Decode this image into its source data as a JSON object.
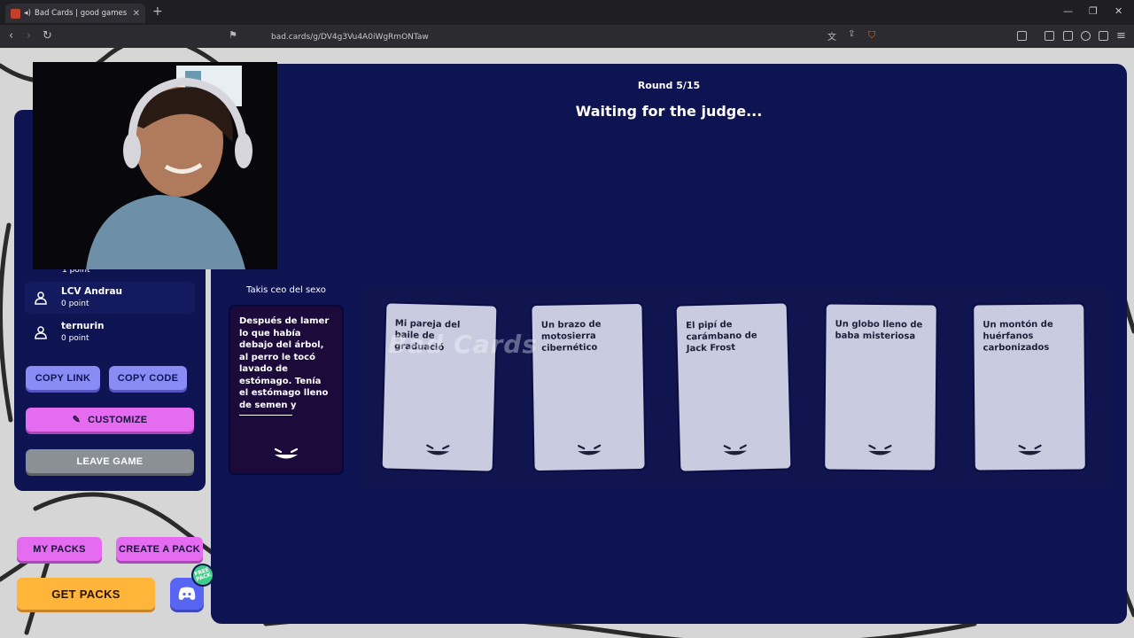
{
  "browser": {
    "tab_title": "Bad Cards | good games for y",
    "url": "bad.cards/g/DV4g3Vu4A0iWgRmONTaw"
  },
  "game": {
    "round_label": "Round 5/15",
    "status_text": "Waiting for the judge...",
    "prompt_player": "Takis ceo del sexo",
    "black_card_text": "Después de lamer lo que había debajo del árbol, al perro le tocó lavado de estómago. Tenía el estómago lleno de semen y",
    "white_cards": [
      "Mi pareja del baile de graduació",
      "Un brazo de motosierra cibernético",
      "El pipí de carámbano de Jack Frost",
      "Un globo lleno de baba misteriosa",
      "Un montón de huérfanos carbonizados"
    ],
    "watermark": "Bad Cards"
  },
  "players": {
    "cut_off_points": "1 point",
    "list": [
      {
        "name": "LCV Andrau",
        "points": "0 point"
      },
      {
        "name": "ternurin",
        "points": "0 point"
      }
    ]
  },
  "actions": {
    "copy_link": "COPY LINK",
    "copy_code": "COPY CODE",
    "customize": "CUSTOMIZE",
    "leave_game": "LEAVE GAME",
    "my_packs": "MY PACKS",
    "create_pack": "CREATE A PACK",
    "get_packs": "GET PACKS",
    "free_badge": "FREE PACK"
  },
  "colors": {
    "panel": "#0e1352",
    "accent_blue": "#8a8cf5",
    "accent_pink": "#e56cf0",
    "accent_orange": "#ffb53a",
    "discord": "#5865f2"
  }
}
